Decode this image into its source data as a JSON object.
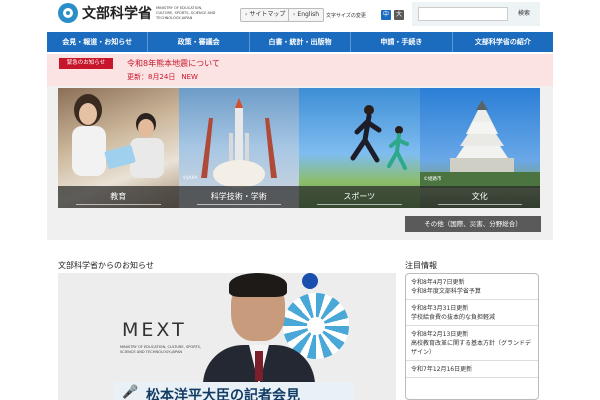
{
  "header": {
    "logo_text": "文部科学省",
    "logo_sub": "MINISTRY OF EDUCATION, CULTURE, SPORTS, SCIENCE AND TECHNOLOGY-JAPAN",
    "sitemap": "サイトマップ",
    "english": "English",
    "font_size_label": "文字サイズの変更",
    "font_small": "中",
    "font_large": "大",
    "search_placeholder": "",
    "search_button": "検索",
    "colors": {
      "logo_blue": "#2a8fc8",
      "font_active": "#1b6cbf"
    }
  },
  "nav": {
    "items": [
      "会見・報道・お知らせ",
      "政策・審議会",
      "白書・統計・出版物",
      "申請・手続き",
      "文部科学省の紹介"
    ],
    "color": "#1b6cbf"
  },
  "alert": {
    "tag": "緊急のお知らせ",
    "title": "令和8年熊本地震について",
    "date": "更新：8月24日",
    "new": "NEW",
    "color": "#c7162b"
  },
  "hero": {
    "tiles": [
      {
        "label": "教育"
      },
      {
        "label": "科学技術・学術",
        "note": "©JAXA"
      },
      {
        "label": "スポーツ"
      },
      {
        "label": "文化",
        "note": "©姫路市"
      }
    ],
    "other_button": "その他（国際、災害、分野総合）"
  },
  "news": {
    "title": "文部科学省からのお知らせ",
    "mext": "MEXT",
    "mext_sub": "MINISTRY OF EDUCATION, CULTURE, SPORTS, SCIENCE AND TECHNOLOGY-JAPAN",
    "press_icon": "microphone-icon",
    "press_text": "松本洋平大臣の記者会見"
  },
  "sidebar": {
    "title": "注目情報",
    "items": [
      {
        "date": "令和8年4月7日更新",
        "text": "令和8年度文部科学省予算"
      },
      {
        "date": "令和8年3月31日更新",
        "text": "学校給食費の抜本的な負担軽減"
      },
      {
        "date": "令和8年2月13日更新",
        "text": "高校教育改革に関する基本方針（グランドデザイン）"
      },
      {
        "date": "令和7年12月16日更新",
        "text": ""
      }
    ]
  }
}
